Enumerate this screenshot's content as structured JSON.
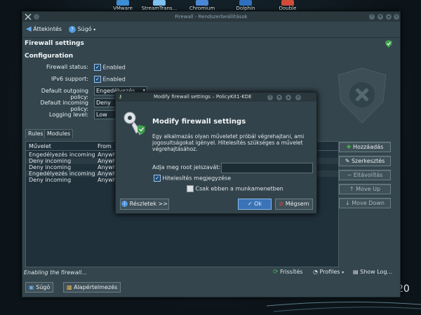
{
  "desktop": {
    "dock": [
      {
        "label": "VMware",
        "color": "#3d8dd4"
      },
      {
        "label": "StreamTrans...",
        "color": "#7ec0f0"
      },
      {
        "label": "Chromium",
        "color": "#4a88d6"
      },
      {
        "label": "Dolphin",
        "color": "#2f6fbf"
      },
      {
        "label": "Double",
        "color": "#d24b3a"
      }
    ],
    "corner_text": "20"
  },
  "window": {
    "title": "Firewall - Rendszerbeállítások",
    "toolbar": {
      "back_label": "Áttekintés",
      "help_label": "Súgó"
    },
    "heading": "Firewall settings",
    "section": "Configuration",
    "fields": {
      "firewall_status": {
        "label": "Firewall status:",
        "value": "Enabled"
      },
      "ipv6": {
        "label": "IPv6 support:",
        "value": "Enabled"
      },
      "outgoing": {
        "label": "Default outgoing policy:",
        "value": "Engedélyezés"
      },
      "incoming": {
        "label": "Default incoming policy:",
        "value": "Deny"
      },
      "logging": {
        "label": "Logging level:",
        "value": "Low"
      }
    },
    "tabs": [
      "Rules",
      "Modules"
    ],
    "table": {
      "headers": [
        "Művelet",
        "From"
      ],
      "rows": [
        [
          "Engedélyezés incoming",
          "Anywhe"
        ],
        [
          "Deny incoming",
          "Anywhe"
        ],
        [
          "Deny incoming",
          "Anywhe"
        ],
        [
          "Engedélyezés incoming",
          "Anywhe"
        ],
        [
          "Deny incoming",
          "Anywhe"
        ]
      ]
    },
    "side_buttons": [
      "Hozzáadás",
      "Szerkesztés",
      "Eltávolítás",
      "Move Up",
      "Move Down"
    ],
    "status": "Enabling the firewall...",
    "refresh_label": "Frissítés",
    "profiles_label": "Profiles",
    "showlog_label": "Show Log...",
    "bottom_buttons": {
      "help": "Súgó",
      "defaults": "Alapértelmezés"
    }
  },
  "dialog": {
    "title": "Modify firewall settings – PolicyKit1-KDE",
    "heading": "Modify firewall settings",
    "message": "Egy alkalmazás olyan műveletet próbál végrehajtani, ami jogosultságokat igényel. Hitelesítés szükséges a művelet végrehajtásához.",
    "password_label": "Adja meg root jelszavát:",
    "password_value": "",
    "remember_label": "Hitelesítés megjegyzése",
    "session_label": "Csak ebben a munkamenetben",
    "details_label": "Részletek >>",
    "ok_label": "Ok",
    "cancel_label": "Mégsem"
  }
}
